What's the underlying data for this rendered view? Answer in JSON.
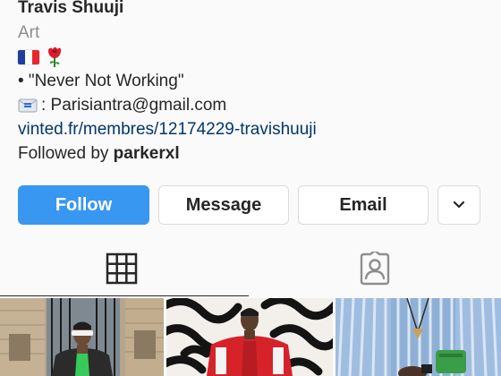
{
  "profile": {
    "name": "Travis Shuuji",
    "category": "Art",
    "emojis": [
      "french-flag",
      "rose"
    ],
    "bio_line1": "• \"Never Not Working\"",
    "bio_line2": ": Parisiantra@gmail.com",
    "link": "vinted.fr/membres/12174229-travishuuji",
    "followed_prefix": "Followed by ",
    "followed_user": "parkerxl"
  },
  "actions": {
    "follow_label": "Follow",
    "message_label": "Message",
    "email_label": "Email",
    "more_icon": "chevron-down-icon"
  },
  "tabs": [
    {
      "icon": "grid-icon",
      "active": true
    },
    {
      "icon": "tagged-person-icon",
      "active": false
    }
  ],
  "colors": {
    "follow_button": "#3897f0",
    "link": "#00376b",
    "muted": "#8e8e8e",
    "text": "#262626"
  }
}
